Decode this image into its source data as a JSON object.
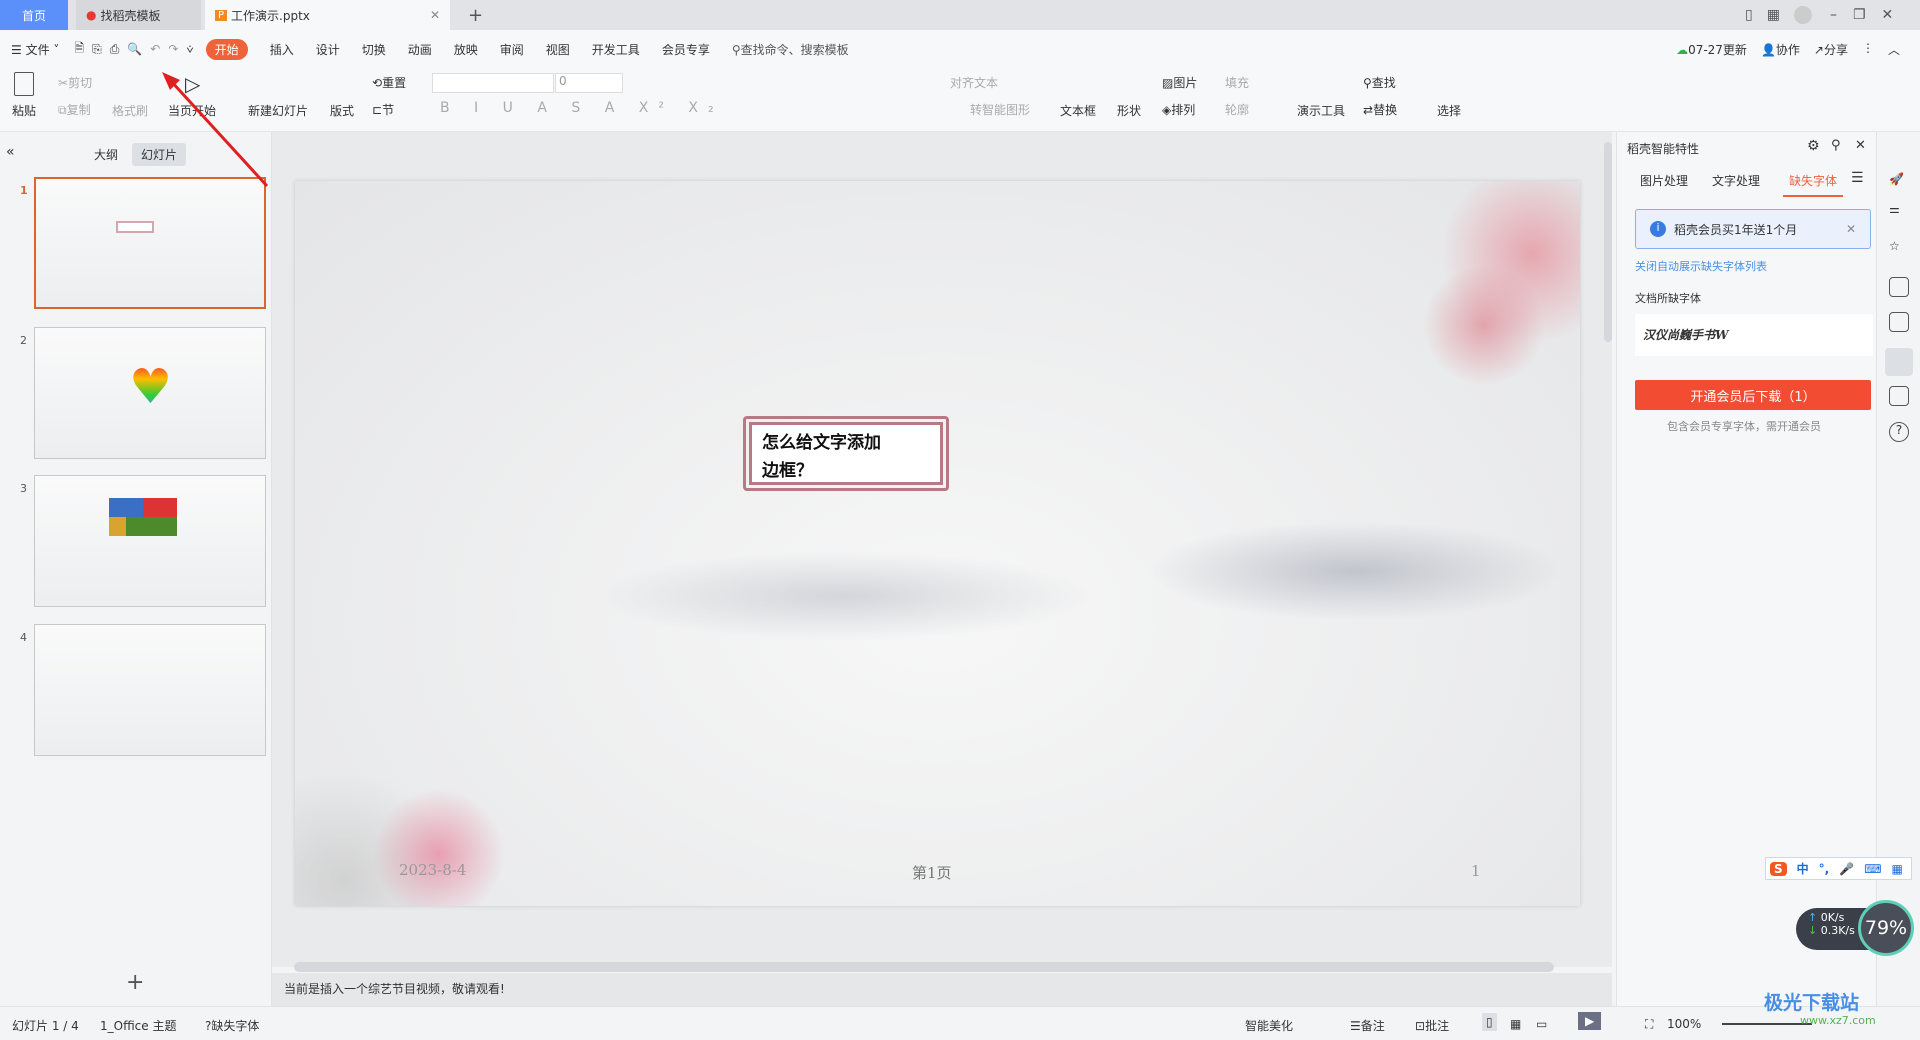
{
  "tabs": [
    {
      "label": "首页"
    },
    {
      "label": "找稻壳模板"
    },
    {
      "label": "工作演示.pptx"
    }
  ],
  "menu": {
    "file": "文件",
    "items": [
      "开始",
      "插入",
      "设计",
      "切换",
      "动画",
      "放映",
      "审阅",
      "视图",
      "开发工具",
      "会员专享"
    ],
    "search_placeholder": "查找命令、搜索模板",
    "update": "07-27更新",
    "collab": "协作",
    "share": "分享"
  },
  "ribbon": {
    "paste": "粘贴",
    "cut": "剪切",
    "copy": "复制",
    "format_painter": "格式刷",
    "from_current": "当页开始",
    "new_slide": "新建幻灯片",
    "layout": "版式",
    "reset": "重置",
    "section": "节",
    "font_size": "0",
    "align_text": "对齐文本",
    "smartart": "转智能图形",
    "textbox": "文本框",
    "shape": "形状",
    "picture": "图片",
    "fill": "填充",
    "arrange": "排列",
    "outline": "轮廓",
    "presenter_tools": "演示工具",
    "find": "查找",
    "replace": "替换",
    "select": "选择"
  },
  "left": {
    "outline_tab": "大纲",
    "slides_tab": "幻灯片",
    "slide_numbers": [
      "1",
      "2",
      "3",
      "4"
    ],
    "add": "+"
  },
  "slide": {
    "title_line1": "怎么给文字添加",
    "title_line2": "边框？",
    "date": "2023-8-4",
    "page_label": "第1页",
    "page_num": "1"
  },
  "notes": "当前是插入一个综艺节目视频，敬请观看!",
  "status": {
    "slide_count": "幻灯片 1 / 4",
    "theme": "1_Office 主题",
    "missing_font": "缺失字体",
    "beautify": "智能美化",
    "notes": "备注",
    "comments": "批注",
    "zoom": "100%"
  },
  "right": {
    "title": "稻壳智能特性",
    "tabs": [
      "图片处理",
      "文字处理",
      "缺失字体"
    ],
    "banner": "稻壳会员买1年送1个月",
    "close_link": "关闭自动展示缺失字体列表",
    "missing_label": "文档所缺字体",
    "missing_font": "汉仪尚巍手书W",
    "download": "开通会员后下载（1）",
    "hint": "包含会员专享字体，需开通会员"
  },
  "widget": {
    "ime": "中",
    "up": "0K/s",
    "down": "0.3K/s",
    "percent": "79%"
  },
  "watermark": {
    "name": "极光下载站",
    "url": "www.xz7.com"
  },
  "colors": {
    "accent": "#f0623a",
    "home_tab": "#5b8ff9",
    "download_btn": "#f24c33",
    "thumb_sel": "#d9672c",
    "link": "#4a90e2"
  }
}
